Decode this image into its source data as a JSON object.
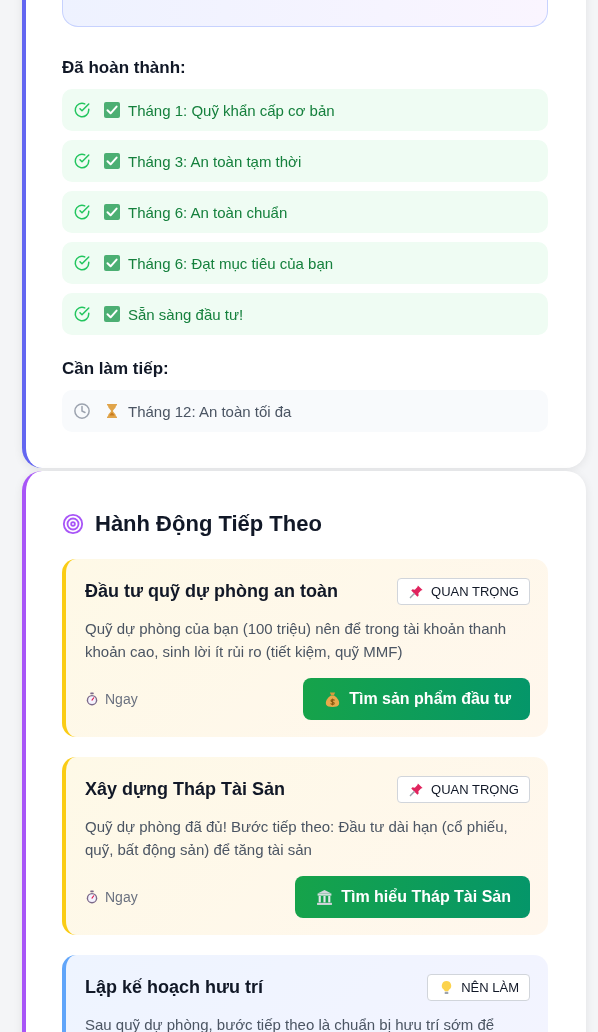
{
  "progress": {
    "done_heading": "Đã hoàn thành:",
    "done": [
      {
        "label": "Tháng 1: Quỹ khẩn cấp cơ bản",
        "done": true
      },
      {
        "label": "Tháng 3: An toàn tạm thời",
        "done": true
      },
      {
        "label": "Tháng 6: An toàn chuẩn",
        "done": true
      },
      {
        "label": "Tháng 6: Đạt mục tiêu của bạn",
        "done": true
      },
      {
        "label": "Sẵn sàng đầu tư!",
        "done": true
      }
    ],
    "todo_heading": "Cần làm tiếp:",
    "todo": [
      {
        "label": "Tháng 12: An toàn tối đa",
        "done": false
      }
    ]
  },
  "next_actions": {
    "title": "Hành Động Tiếp Theo",
    "cards": [
      {
        "kind": "important",
        "title": "Đầu tư quỹ dự phòng an toàn",
        "badge": "QUAN TRỌNG",
        "description": "Quỹ dự phòng của bạn (100 triệu) nên để trong tài khoản thanh khoản cao, sinh lời ít rủi ro (tiết kiệm, quỹ MMF)",
        "timing": "Ngay",
        "button": {
          "kind": "invest",
          "label": "Tìm sản phẩm đầu tư"
        }
      },
      {
        "kind": "important",
        "title": "Xây dựng Tháp Tài Sản",
        "badge": "QUAN TRỌNG",
        "description": "Quỹ dự phòng đã đủ! Bước tiếp theo: Đầu tư dài hạn (cổ phiếu, quỹ, bất động sản) để tăng tài sản",
        "timing": "Ngay",
        "button": {
          "kind": "learn",
          "label": "Tìm hiểu Tháp Tài Sản"
        }
      },
      {
        "kind": "recommended",
        "title": "Lập kế hoạch hưu trí",
        "badge": "NÊN LÀM",
        "description": "Sau quỹ dự phòng, bước tiếp theo là chuẩn bị hưu trí sớm để"
      }
    ]
  }
}
